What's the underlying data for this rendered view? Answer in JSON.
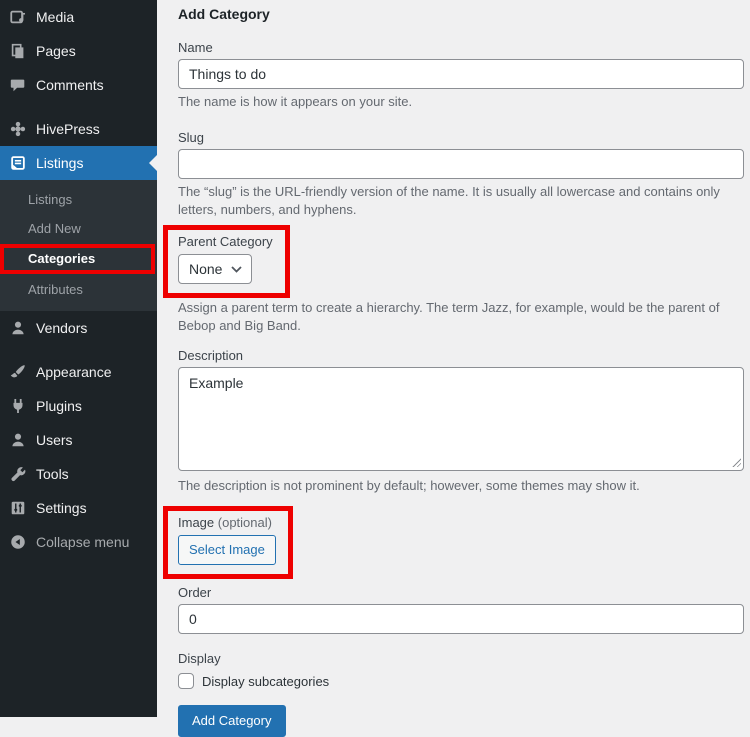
{
  "colors": {
    "accent": "#2271b1",
    "highlight_box": "#ee0000",
    "sidebar_bg": "#1d2327",
    "submenu_bg": "#2c3338",
    "content_bg": "#f0f0f1"
  },
  "sidebar": {
    "items_top": [
      {
        "label": "Media",
        "icon": "media-icon"
      },
      {
        "label": "Pages",
        "icon": "pages-icon"
      },
      {
        "label": "Comments",
        "icon": "comments-icon"
      }
    ],
    "hivepress": {
      "label": "HivePress",
      "icon": "hivepress-icon"
    },
    "listings": {
      "label": "Listings",
      "icon": "listings-icon",
      "active": true
    },
    "listings_submenu": [
      {
        "label": "Listings"
      },
      {
        "label": "Add New"
      },
      {
        "label": "Categories",
        "current": true,
        "highlighted": true
      },
      {
        "label": "Attributes"
      }
    ],
    "vendors": {
      "label": "Vendors",
      "icon": "vendors-icon"
    },
    "items_bottom": [
      {
        "label": "Appearance",
        "icon": "appearance-icon"
      },
      {
        "label": "Plugins",
        "icon": "plugins-icon"
      },
      {
        "label": "Users",
        "icon": "users-icon"
      },
      {
        "label": "Tools",
        "icon": "tools-icon"
      },
      {
        "label": "Settings",
        "icon": "settings-icon"
      }
    ],
    "collapse": {
      "label": "Collapse menu",
      "icon": "collapse-icon"
    }
  },
  "form": {
    "title": "Add Category",
    "name": {
      "label": "Name",
      "value": "Things to do",
      "help": "The name is how it appears on your site."
    },
    "slug": {
      "label": "Slug",
      "value": "",
      "help": "The “slug” is the URL-friendly version of the name. It is usually all lowercase and contains only letters, numbers, and hyphens."
    },
    "parent": {
      "label": "Parent Category",
      "selected": "None",
      "help": "Assign a parent term to create a hierarchy. The term Jazz, for example, would be the parent of Bebop and Big Band."
    },
    "description": {
      "label": "Description",
      "value": "Example",
      "help": "The description is not prominent by default; however, some themes may show it."
    },
    "image": {
      "label": "Image",
      "optional": "(optional)",
      "button": "Select Image"
    },
    "order": {
      "label": "Order",
      "value": "0"
    },
    "display": {
      "label": "Display",
      "checkbox_label": "Display subcategories",
      "checked": false
    },
    "submit": "Add Category"
  }
}
